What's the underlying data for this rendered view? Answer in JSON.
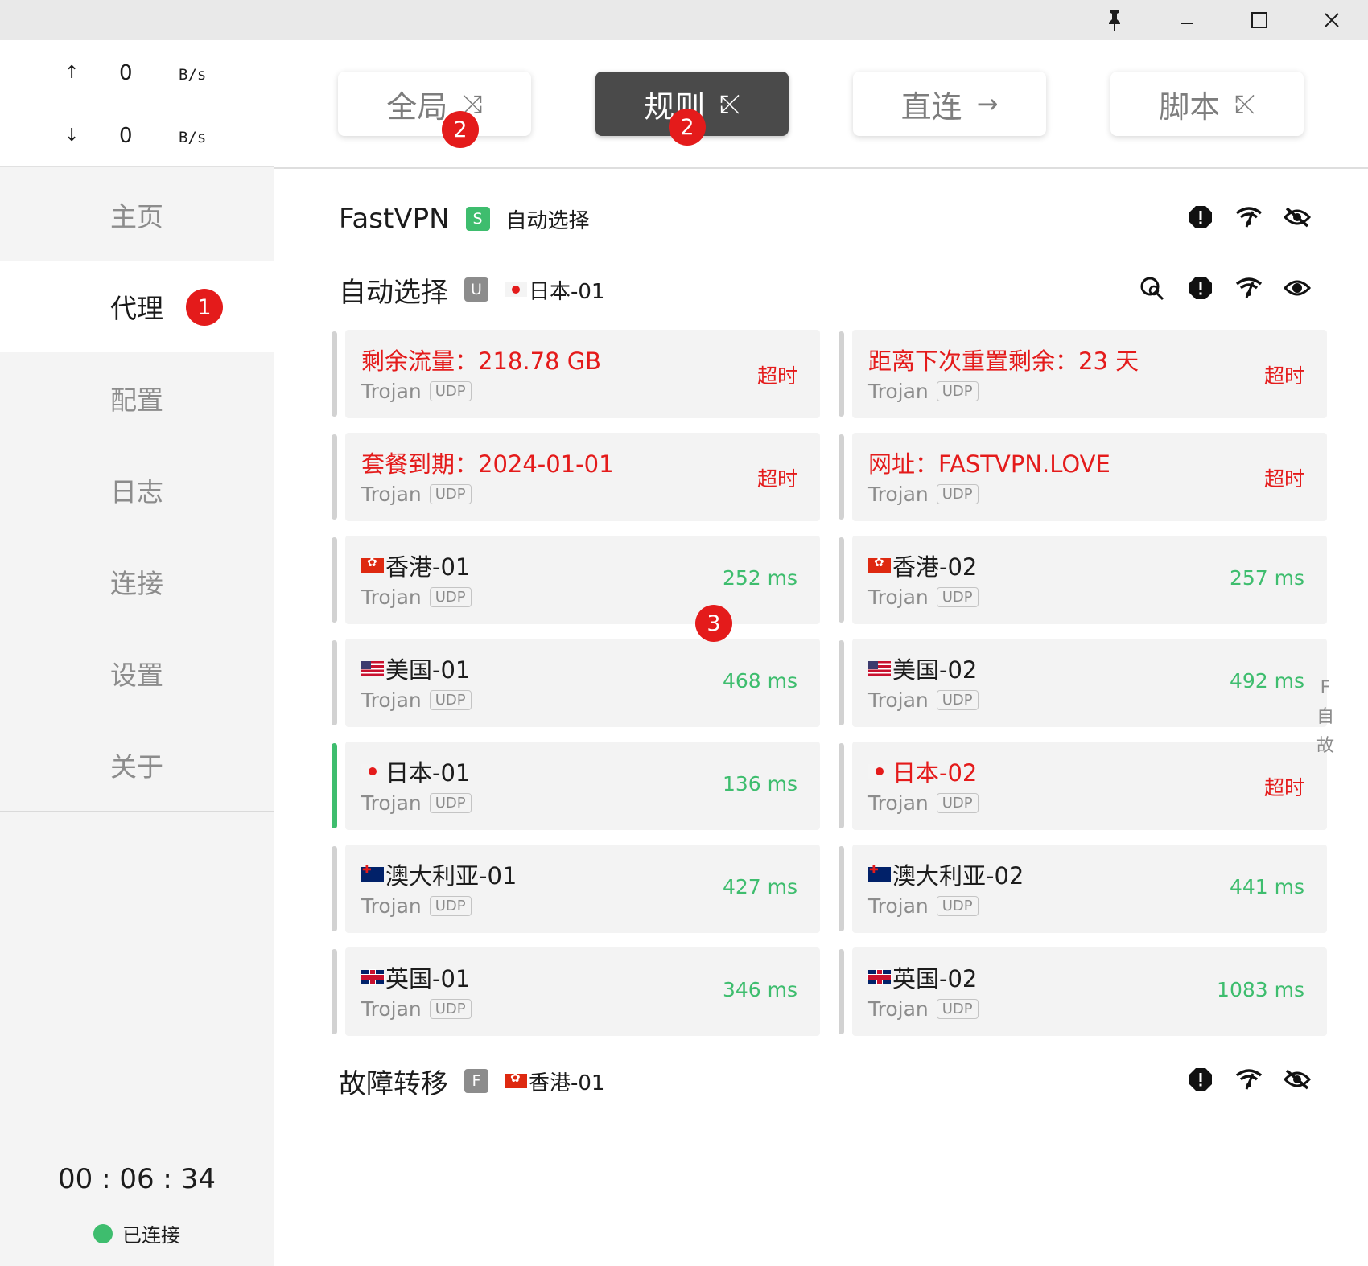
{
  "titlebar": {
    "icons": [
      "pin-icon",
      "minimize-icon",
      "maximize-icon",
      "close-icon"
    ]
  },
  "traffic": {
    "up": {
      "arrow": "↑",
      "value": "0",
      "unit": "B/s"
    },
    "down": {
      "arrow": "↓",
      "value": "0",
      "unit": "B/s"
    }
  },
  "nav": {
    "items": [
      {
        "label": "主页"
      },
      {
        "label": "代理",
        "badge": "1"
      },
      {
        "label": "配置"
      },
      {
        "label": "日志"
      },
      {
        "label": "连接"
      },
      {
        "label": "设置"
      },
      {
        "label": "关于"
      }
    ],
    "active_index": 1
  },
  "footer": {
    "timer": "00 : 06 : 34",
    "status": "已连接",
    "status_color": "#3ebd6e"
  },
  "modes": [
    {
      "label": "全局",
      "icon": "⤨",
      "badge": "2"
    },
    {
      "label": "规则",
      "icon": "⤪",
      "badge": "2",
      "active": true
    },
    {
      "label": "直连",
      "icon": "→"
    },
    {
      "label": "脚本",
      "icon": "⤪"
    }
  ],
  "groups": {
    "fastvpn": {
      "name": "FastVPN",
      "tag": "S",
      "tag_color": "#3ebd6e",
      "selected": "自动选择"
    },
    "auto": {
      "name": "自动选择",
      "tag": "U",
      "tag_color": "#8c8c8c",
      "selected": "日本-01",
      "selected_flag": "jp"
    },
    "failover": {
      "name": "故障转移",
      "tag": "F",
      "tag_color": "#8c8c8c",
      "selected": "香港-01",
      "selected_flag": "hk"
    }
  },
  "proxies": [
    {
      "name": "剩余流量：218.78 GB",
      "type": "Trojan",
      "udp": "UDP",
      "delay": "超时",
      "name_red": true
    },
    {
      "name": "距离下次重置剩余：23 天",
      "type": "Trojan",
      "udp": "UDP",
      "delay": "超时",
      "name_red": true
    },
    {
      "name": "套餐到期：2024-01-01",
      "type": "Trojan",
      "udp": "UDP",
      "delay": "超时",
      "name_red": true
    },
    {
      "name": "网址：FASTVPN.LOVE",
      "type": "Trojan",
      "udp": "UDP",
      "delay": "超时",
      "name_red": true
    },
    {
      "name": "香港-01",
      "flag": "hk",
      "type": "Trojan",
      "udp": "UDP",
      "delay": "252 ms"
    },
    {
      "name": "香港-02",
      "flag": "hk",
      "type": "Trojan",
      "udp": "UDP",
      "delay": "257 ms"
    },
    {
      "name": "美国-01",
      "flag": "us",
      "type": "Trojan",
      "udp": "UDP",
      "delay": "468 ms"
    },
    {
      "name": "美国-02",
      "flag": "us",
      "type": "Trojan",
      "udp": "UDP",
      "delay": "492 ms"
    },
    {
      "name": "日本-01",
      "flag": "jp",
      "type": "Trojan",
      "udp": "UDP",
      "delay": "136 ms",
      "selected": true
    },
    {
      "name": "日本-02",
      "flag": "jp",
      "type": "Trojan",
      "udp": "UDP",
      "delay": "超时",
      "name_red": true
    },
    {
      "name": "澳大利亚-01",
      "flag": "au",
      "type": "Trojan",
      "udp": "UDP",
      "delay": "427 ms"
    },
    {
      "name": "澳大利亚-02",
      "flag": "au",
      "type": "Trojan",
      "udp": "UDP",
      "delay": "441 ms"
    },
    {
      "name": "英国-01",
      "flag": "uk",
      "type": "Trojan",
      "udp": "UDP",
      "delay": "346 ms"
    },
    {
      "name": "英国-02",
      "flag": "uk",
      "type": "Trojan",
      "udp": "UDP",
      "delay": "1083 ms"
    }
  ],
  "card_badge": "3",
  "edge_index": [
    "F",
    "自",
    "故"
  ],
  "colors": {
    "ok": "#3ebd6e",
    "timeout": "#e41b1b",
    "active_mode": "#4a4a4a",
    "badge": "#e41b1b"
  }
}
